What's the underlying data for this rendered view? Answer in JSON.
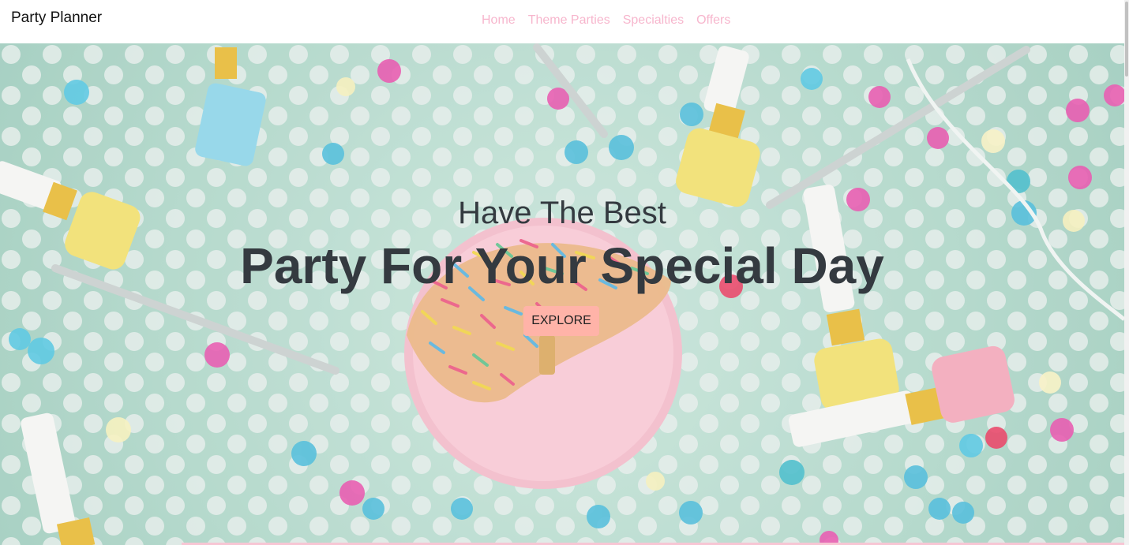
{
  "navbar": {
    "brand": "Party Planner",
    "links": [
      "Home",
      "Theme Parties",
      "Specialties",
      "Offers"
    ]
  },
  "hero": {
    "subtitle": "Have The Best",
    "title": "Party For Your Special Day",
    "button_label": "EXPLORE"
  },
  "colors": {
    "nav_link": "#f7b6cd",
    "hero_text": "#343a40",
    "button_bg": "#ffb3a8",
    "hero_bg": "#a9d3c4"
  }
}
